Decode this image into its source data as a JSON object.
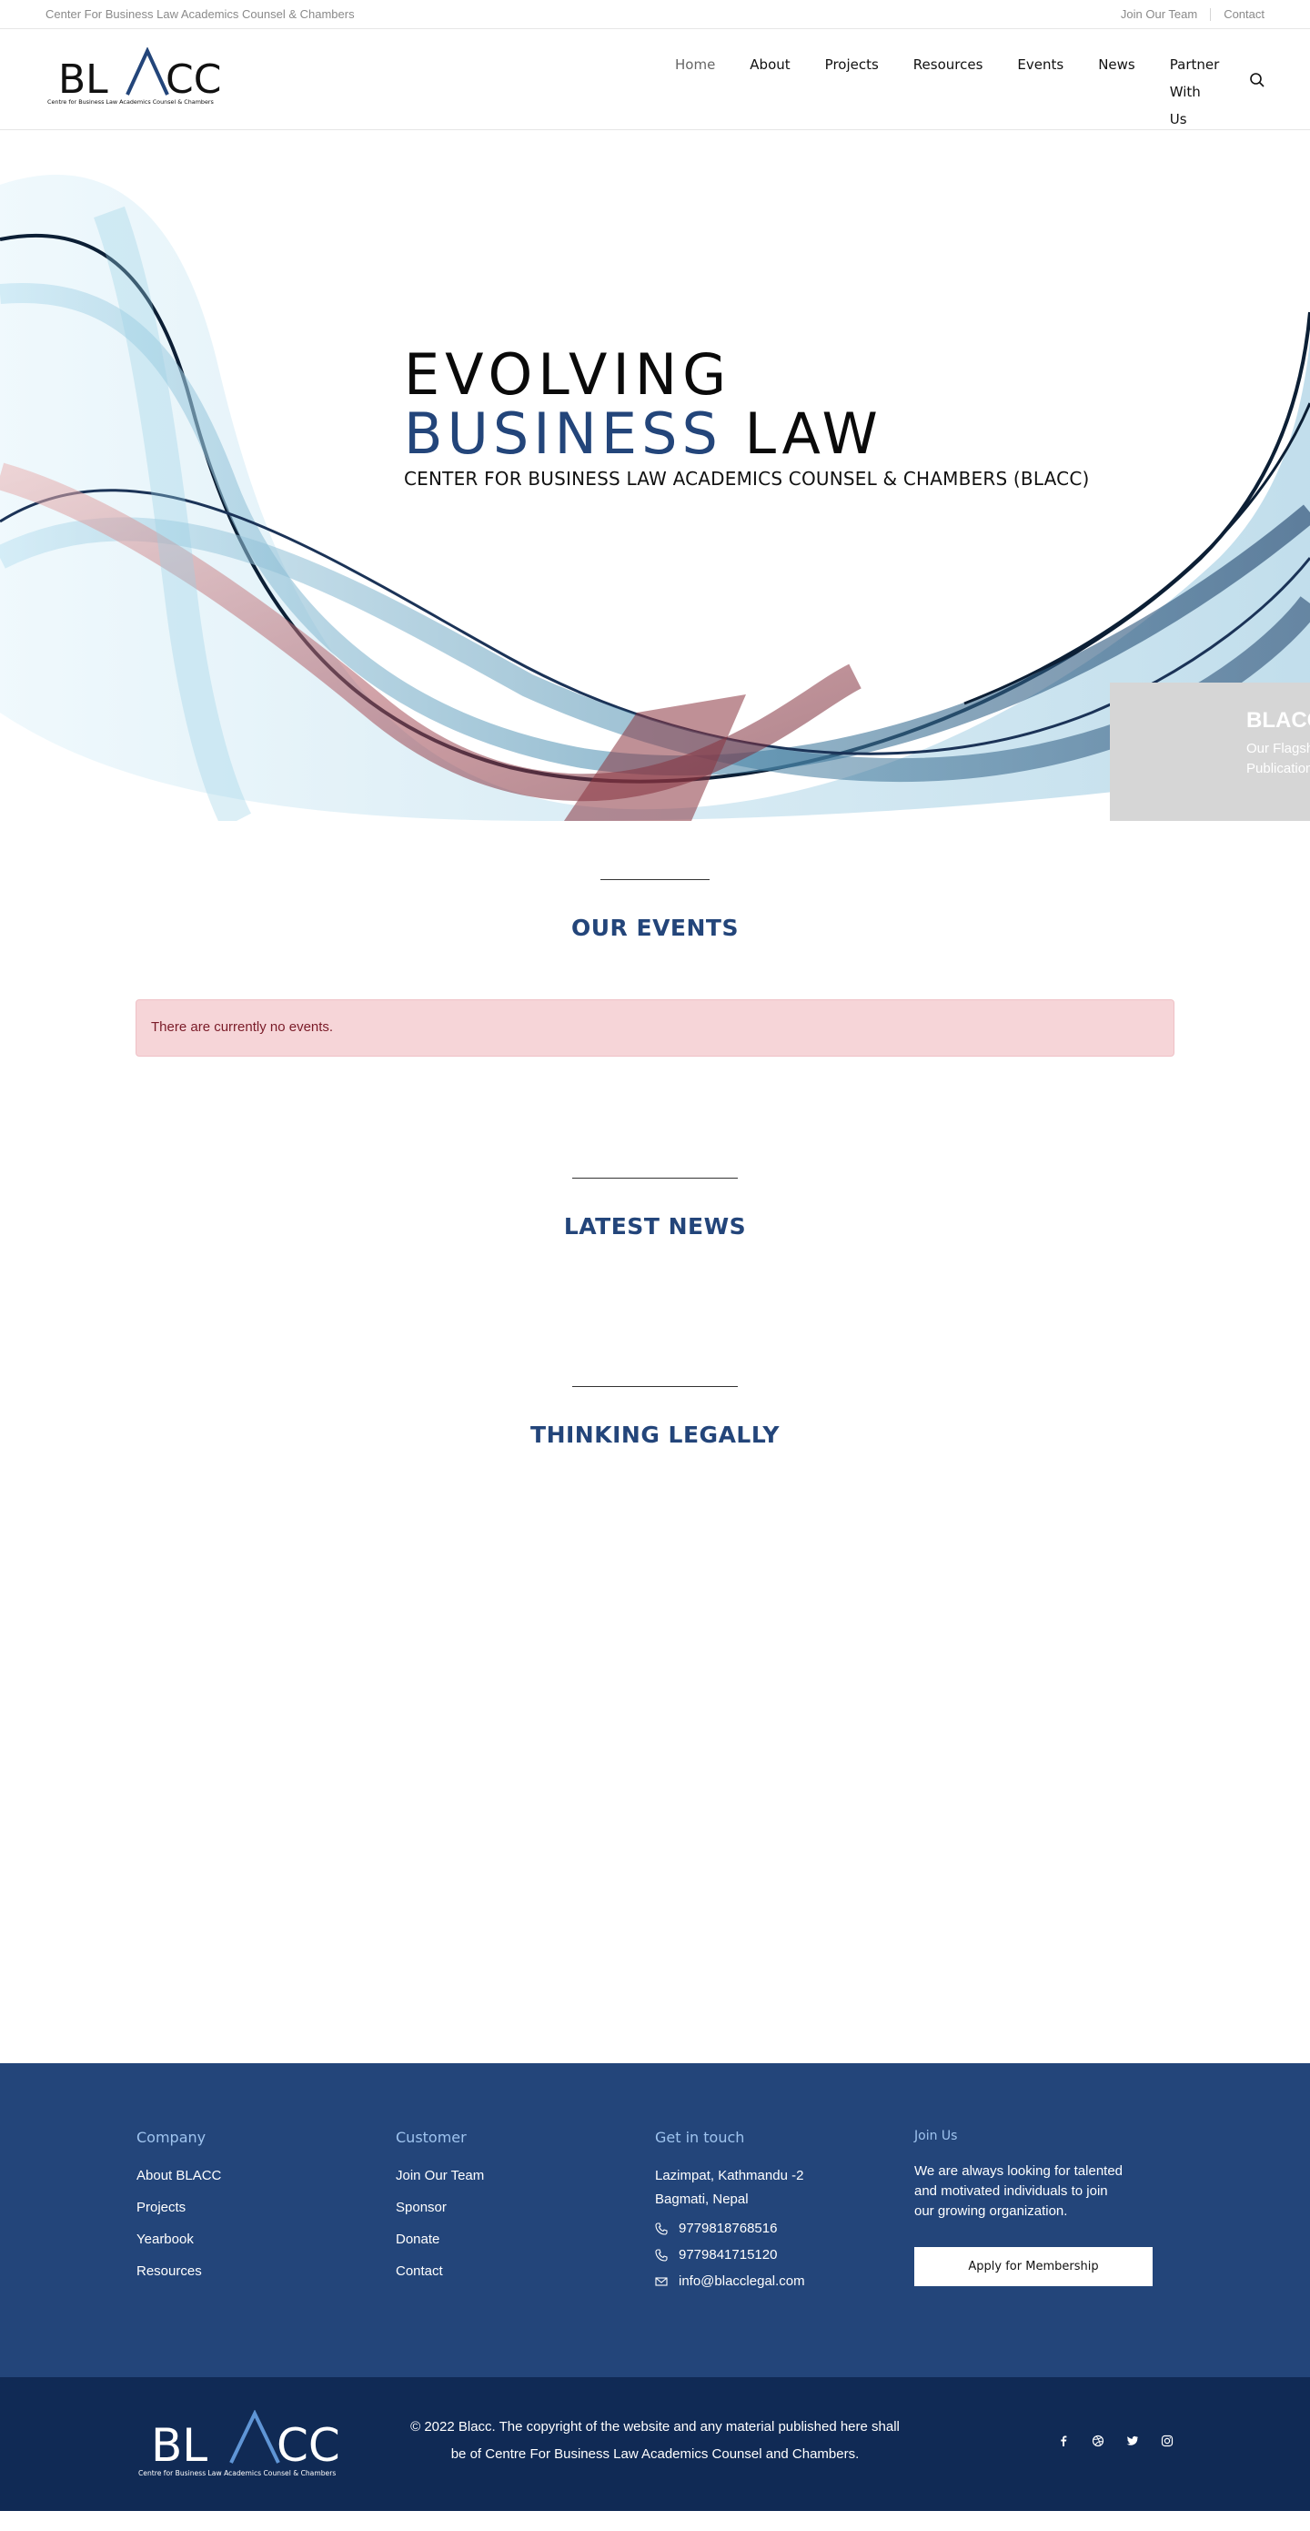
{
  "topbar": {
    "org_name": "Center For Business Law Academics Counsel & Chambers",
    "join_label": "Join Our Team",
    "contact_label": "Contact"
  },
  "logo": {
    "wordmark_left": "BL",
    "wordmark_right": "CC",
    "tagline": "Centre for Business Law Academics Counsel & Chambers"
  },
  "nav": {
    "items": [
      "Home",
      "About",
      "Projects",
      "Resources",
      "Events",
      "News",
      "Partner With Us"
    ],
    "active": "Home",
    "search_icon": "search-icon"
  },
  "hero": {
    "line1": "EVOLVING",
    "line2_blue": "BUSINESS",
    "line2_dark": "LAW",
    "subtitle": "CENTER FOR BUSINESS LAW ACADEMICS COUNSEL & CHAMBERS (BLACC)",
    "side_card": {
      "title": "BLACC",
      "line1": "Our Flagship",
      "line2": "Publication"
    }
  },
  "events": {
    "title": "OUR EVENTS",
    "empty_message": "There are currently no events."
  },
  "news": {
    "title": "LATEST NEWS"
  },
  "thinking": {
    "title": "THINKING LEGALLY"
  },
  "footer": {
    "company": {
      "heading": "Company",
      "links": [
        "About BLACC",
        "Projects",
        "Yearbook",
        "Resources"
      ]
    },
    "customer": {
      "heading": "Customer",
      "links": [
        "Join Our Team",
        "Sponsor",
        "Donate",
        "Contact"
      ]
    },
    "touch": {
      "heading": "Get in touch",
      "address_line1": "Lazimpat, Kathmandu -2",
      "address_line2": "Bagmati, Nepal",
      "phone1": "9779818768516",
      "phone2": "9779841715120",
      "email": "info@blacclegal.com"
    },
    "join": {
      "heading": "Join Us",
      "text": "We are always looking for talented and motivated individuals to join our growing organization.",
      "button": "Apply for Membership"
    }
  },
  "bottom": {
    "copyright_line1": "© 2022 Blacc. The copyright of the website and any material published here shall",
    "copyright_line2": "be of Centre For Business Law Academics Counsel and Chambers.",
    "social": [
      "facebook-icon",
      "dribbble-icon",
      "twitter-icon",
      "instagram-icon"
    ]
  },
  "colors": {
    "brand_blue": "#23457a",
    "footer_bottom": "#102a55",
    "accent_light_blue": "#9fc4ef",
    "alert_bg": "#f6d5d8"
  }
}
